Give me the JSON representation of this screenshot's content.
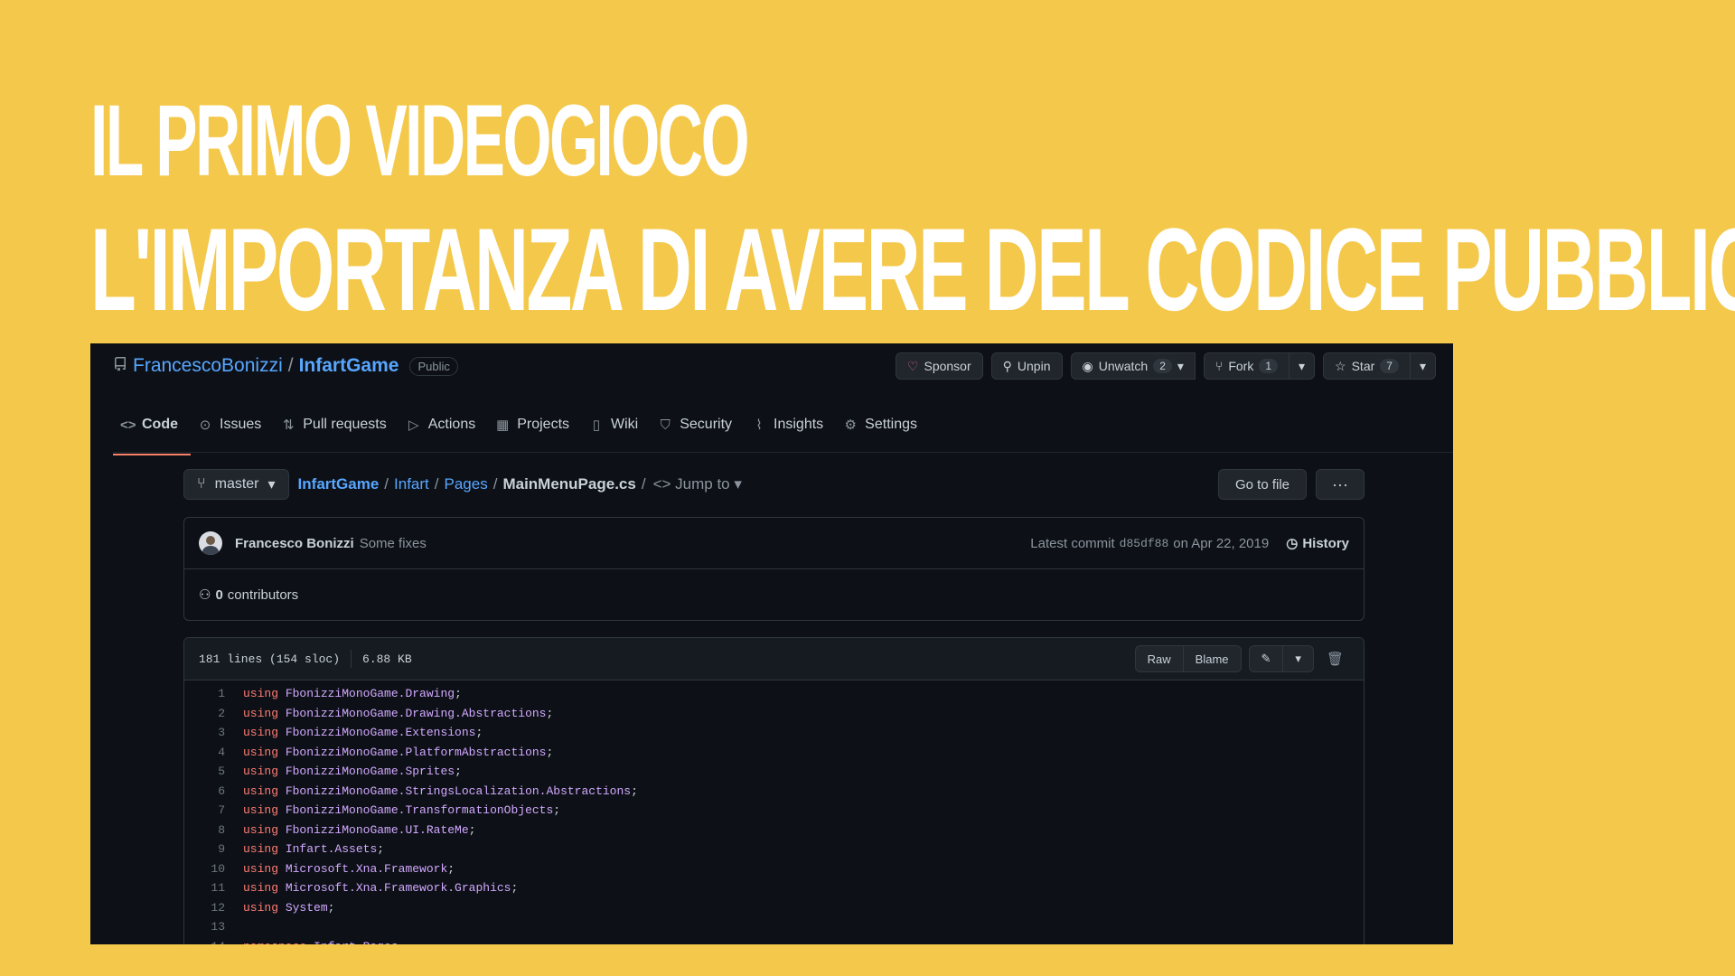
{
  "slide": {
    "title_line1": "IL PRIMO VIDEOGIOCO",
    "title_line2": "L'IMPORTANZA DI AVERE DEL CODICE PUBBLICO",
    "background_color": "#F4C84A"
  },
  "repo": {
    "owner": "FrancescoBonizzi",
    "separator": "/",
    "name": "InfartGame",
    "visibility": "Public"
  },
  "actions": {
    "sponsor": "Sponsor",
    "unpin": "Unpin",
    "unwatch": "Unwatch",
    "unwatch_count": "2",
    "fork": "Fork",
    "fork_count": "1",
    "star": "Star",
    "star_count": "7"
  },
  "tabs": [
    {
      "label": "Code",
      "icon": "code-icon"
    },
    {
      "label": "Issues",
      "icon": "issue-icon"
    },
    {
      "label": "Pull requests",
      "icon": "pull-request-icon"
    },
    {
      "label": "Actions",
      "icon": "play-icon"
    },
    {
      "label": "Projects",
      "icon": "table-icon"
    },
    {
      "label": "Wiki",
      "icon": "book-icon"
    },
    {
      "label": "Security",
      "icon": "shield-icon"
    },
    {
      "label": "Insights",
      "icon": "graph-icon"
    },
    {
      "label": "Settings",
      "icon": "gear-icon"
    }
  ],
  "file_nav": {
    "branch": "master",
    "crumbs": [
      "InfartGame",
      "Infart",
      "Pages"
    ],
    "file": "MainMenuPage.cs",
    "jump_to": "Jump to",
    "go_to_file": "Go to file",
    "more": "···"
  },
  "commit": {
    "author": "Francesco Bonizzi",
    "message": "Some fixes",
    "latest_label": "Latest commit",
    "hash": "d85df88",
    "date": "on Apr 22, 2019",
    "history": "History"
  },
  "contributors": {
    "count": "0",
    "label": "contributors"
  },
  "file_info": {
    "lines": "181 lines (154 sloc)",
    "size": "6.88 KB",
    "raw": "Raw",
    "blame": "Blame"
  },
  "code": {
    "lines": [
      {
        "n": "1",
        "kw": "using",
        "ns": "FbonizziMonoGame.Drawing",
        "end": ";"
      },
      {
        "n": "2",
        "kw": "using",
        "ns": "FbonizziMonoGame.Drawing.Abstractions",
        "end": ";"
      },
      {
        "n": "3",
        "kw": "using",
        "ns": "FbonizziMonoGame.Extensions",
        "end": ";"
      },
      {
        "n": "4",
        "kw": "using",
        "ns": "FbonizziMonoGame.PlatformAbstractions",
        "end": ";"
      },
      {
        "n": "5",
        "kw": "using",
        "ns": "FbonizziMonoGame.Sprites",
        "end": ";"
      },
      {
        "n": "6",
        "kw": "using",
        "ns": "FbonizziMonoGame.StringsLocalization.Abstractions",
        "end": ";"
      },
      {
        "n": "7",
        "kw": "using",
        "ns": "FbonizziMonoGame.TransformationObjects",
        "end": ";"
      },
      {
        "n": "8",
        "kw": "using",
        "ns": "FbonizziMonoGame.UI.RateMe",
        "end": ";"
      },
      {
        "n": "9",
        "kw": "using",
        "ns": "Infart.Assets",
        "end": ";"
      },
      {
        "n": "10",
        "kw": "using",
        "ns": "Microsoft.Xna.Framework",
        "end": ";"
      },
      {
        "n": "11",
        "kw": "using",
        "ns": "Microsoft.Xna.Framework.Graphics",
        "end": ";"
      },
      {
        "n": "12",
        "kw": "using",
        "ns": "System",
        "end": ";"
      },
      {
        "n": "13",
        "kw": "",
        "ns": "",
        "end": ""
      },
      {
        "n": "14",
        "kw": "namespace",
        "ns": "Infart.Pages",
        "end": ""
      }
    ]
  }
}
